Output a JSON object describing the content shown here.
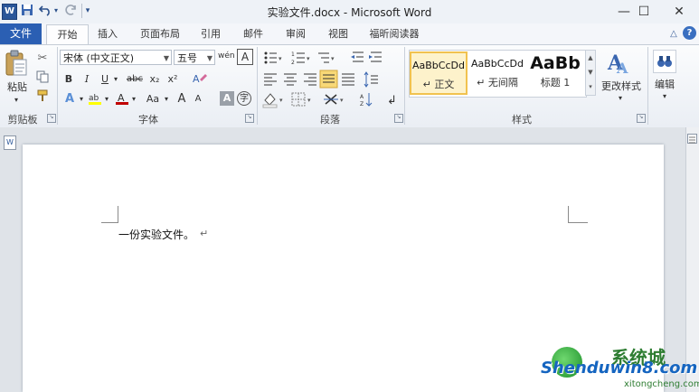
{
  "window": {
    "title": "实验文件.docx - Microsoft Word",
    "app_icon": "W",
    "quick_access": {
      "save_icon": "save-icon",
      "undo_icon": "undo-icon",
      "redo_icon": "redo-icon",
      "customize_icon": "customize-icon"
    },
    "controls": {
      "minimize": "—",
      "maximize": "☐",
      "close": "✕"
    }
  },
  "tabs": [
    "文件",
    "开始",
    "插入",
    "页面布局",
    "引用",
    "邮件",
    "审阅",
    "视图",
    "福昕阅读器"
  ],
  "help": {
    "collapse": "△",
    "help": "?"
  },
  "ribbon": {
    "clipboard": {
      "paste_label": "粘贴",
      "group": "剪贴板"
    },
    "font": {
      "font_name": "宋体 (中文正文)",
      "font_size": "五号",
      "wen": "wén",
      "group": "字体",
      "bold": "B",
      "italic": "I",
      "underline": "U",
      "strike": "abc",
      "sub": "x₂",
      "sup": "x²",
      "grow": "A",
      "shrink": "A",
      "case": "Aa",
      "charbox": "A",
      "enclose": "字"
    },
    "paragraph": {
      "group": "段落"
    },
    "styles": {
      "group": "样式",
      "items": [
        {
          "sample": "AaBbCcDd",
          "name": "↵ 正文"
        },
        {
          "sample": "AaBbCcDd",
          "name": "↵ 无间隔"
        },
        {
          "sample": "AaBb",
          "name": "标题 1"
        }
      ],
      "change_styles": "更改样式"
    },
    "editing": {
      "label": "编辑"
    }
  },
  "document": {
    "text": "一份实验文件。",
    "para_mark": "↵"
  },
  "watermark": {
    "site": "Shenduwin8.com",
    "cn": "系统城",
    "url": "xitongcheng.com"
  },
  "colors": {
    "file_tab": "#2b5fb3",
    "highlight": "#ffff00",
    "font_color": "#c00000",
    "selected_style_border": "#f1c24f"
  }
}
